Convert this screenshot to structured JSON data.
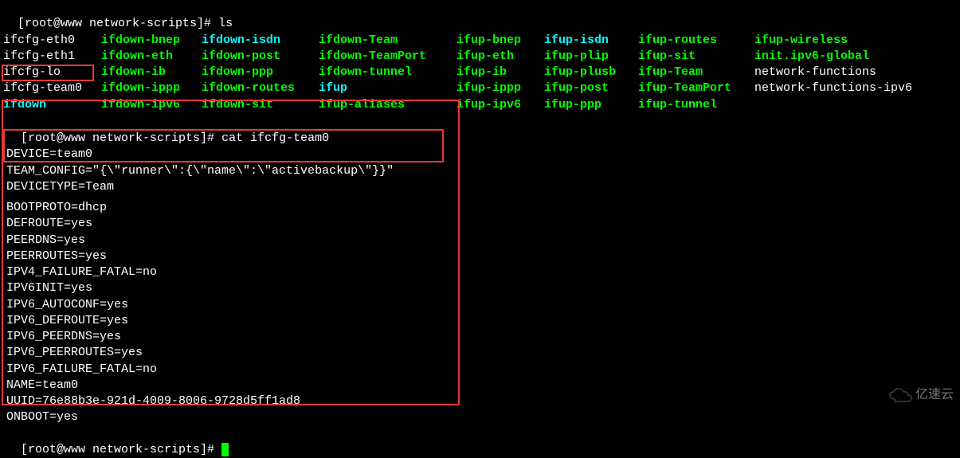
{
  "prompt1": "[root@www network-scripts]# ",
  "cmd1": "ls",
  "ls": {
    "cols": [
      [
        "ifcfg-eth0",
        "ifcfg-eth1",
        "ifcfg-lo",
        "ifcfg-team0",
        "ifdown"
      ],
      [
        "ifdown-bnep",
        "ifdown-eth",
        "ifdown-ib",
        "ifdown-ippp",
        "ifdown-ipv6"
      ],
      [
        "ifdown-isdn",
        "ifdown-post",
        "ifdown-ppp",
        "ifdown-routes",
        "ifdown-sit"
      ],
      [
        "ifdown-Team",
        "ifdown-TeamPort",
        "ifdown-tunnel",
        "ifup",
        "ifup-aliases"
      ],
      [
        "ifup-bnep",
        "ifup-eth",
        "ifup-ib",
        "ifup-ippp",
        "ifup-ipv6"
      ],
      [
        "ifup-isdn",
        "ifup-plip",
        "ifup-plusb",
        "ifup-post",
        "ifup-ppp"
      ],
      [
        "ifup-routes",
        "ifup-sit",
        "ifup-Team",
        "ifup-TeamPort",
        "ifup-tunnel"
      ],
      [
        "ifup-wireless",
        "init.ipv6-global",
        "network-functions",
        "network-functions-ipv6",
        ""
      ]
    ],
    "classes": [
      [
        "white",
        "white",
        "white",
        "white",
        "cyan"
      ],
      [
        "green",
        "green",
        "green",
        "green",
        "green"
      ],
      [
        "cyan",
        "green",
        "green",
        "green",
        "green"
      ],
      [
        "green",
        "green",
        "green",
        "cyan",
        "green"
      ],
      [
        "green",
        "green",
        "green",
        "green",
        "green"
      ],
      [
        "cyan",
        "green",
        "green",
        "green",
        "green"
      ],
      [
        "green",
        "green",
        "green",
        "green",
        "green"
      ],
      [
        "green",
        "green",
        "white",
        "white",
        "white"
      ]
    ]
  },
  "prompt2": "[root@www network-scripts]# ",
  "cmd2": "cat ifcfg-team0",
  "config": {
    "device": "DEVICE=team0",
    "team_config": "TEAM_CONFIG=\"{\\\"runner\\\":{\\\"name\\\":\\\"activebackup\\\"}}\"",
    "devicetype": "DEVICETYPE=Team",
    "lines_after": [
      "BOOTPROTO=dhcp",
      "DEFROUTE=yes",
      "PEERDNS=yes",
      "PEERROUTES=yes",
      "IPV4_FAILURE_FATAL=no",
      "IPV6INIT=yes",
      "IPV6_AUTOCONF=yes",
      "IPV6_DEFROUTE=yes",
      "IPV6_PEERDNS=yes",
      "IPV6_PEERROUTES=yes",
      "IPV6_FAILURE_FATAL=no",
      "NAME=team0",
      "UUID=76e88b3e-921d-4009-8006-9728d5ff1ad8",
      "ONBOOT=yes"
    ]
  },
  "prompt3": "[root@www network-scripts]# ",
  "watermark": "亿速云"
}
